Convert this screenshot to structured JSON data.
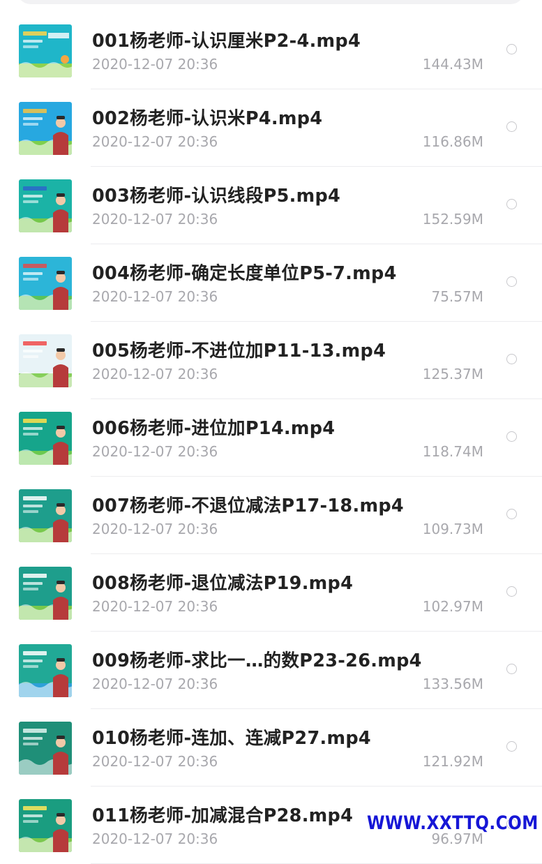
{
  "colors": {
    "title": "#222222",
    "meta": "#a8a8ad",
    "radio_border": "#c8c8cc",
    "watermark": "#1616d6"
  },
  "files": [
    {
      "name": "001杨老师-认识厘米P2-4.mp4",
      "date": "2020-12-07 20:36",
      "size": "144.43M",
      "thumb_icon": "video-thumbnail-icon",
      "thumb_style": "ruler"
    },
    {
      "name": "002杨老师-认识米P4.mp4",
      "date": "2020-12-07 20:36",
      "size": "116.86M",
      "thumb_icon": "video-thumbnail-icon",
      "thumb_style": "sky"
    },
    {
      "name": "003杨老师-认识线段P5.mp4",
      "date": "2020-12-07 20:36",
      "size": "152.59M",
      "thumb_icon": "video-thumbnail-icon",
      "thumb_style": "teal"
    },
    {
      "name": "004杨老师-确定长度单位P5-7.mp4",
      "date": "2020-12-07 20:36",
      "size": "75.57M",
      "thumb_icon": "video-thumbnail-icon",
      "thumb_style": "quiz"
    },
    {
      "name": "005杨老师-不进位加P11-13.mp4",
      "date": "2020-12-07 20:36",
      "size": "125.37M",
      "thumb_icon": "video-thumbnail-icon",
      "thumb_style": "light"
    },
    {
      "name": "006杨老师-进位加P14.mp4",
      "date": "2020-12-07 20:36",
      "size": "118.74M",
      "thumb_icon": "video-thumbnail-icon",
      "thumb_style": "green"
    },
    {
      "name": "007杨老师-不退位减法P17-18.mp4",
      "date": "2020-12-07 20:36",
      "size": "109.73M",
      "thumb_icon": "video-thumbnail-icon",
      "thumb_style": "teacher"
    },
    {
      "name": "008杨老师-退位减法P19.mp4",
      "date": "2020-12-07 20:36",
      "size": "102.97M",
      "thumb_icon": "video-thumbnail-icon",
      "thumb_style": "teacher"
    },
    {
      "name": "009杨老师-求比一…的数P23-26.mp4",
      "date": "2020-12-07 20:36",
      "size": "133.56M",
      "thumb_icon": "video-thumbnail-icon",
      "thumb_style": "board"
    },
    {
      "name": "010杨老师-连加、连减P27.mp4",
      "date": "2020-12-07 20:36",
      "size": "121.92M",
      "thumb_icon": "video-thumbnail-icon",
      "thumb_style": "chalk"
    },
    {
      "name": "011杨老师-加减混合P28.mp4",
      "date": "2020-12-07 20:36",
      "size": "96.97M",
      "thumb_icon": "video-thumbnail-icon",
      "thumb_style": "mixed"
    }
  ],
  "watermark": "WWW.XXTTQ.COM"
}
